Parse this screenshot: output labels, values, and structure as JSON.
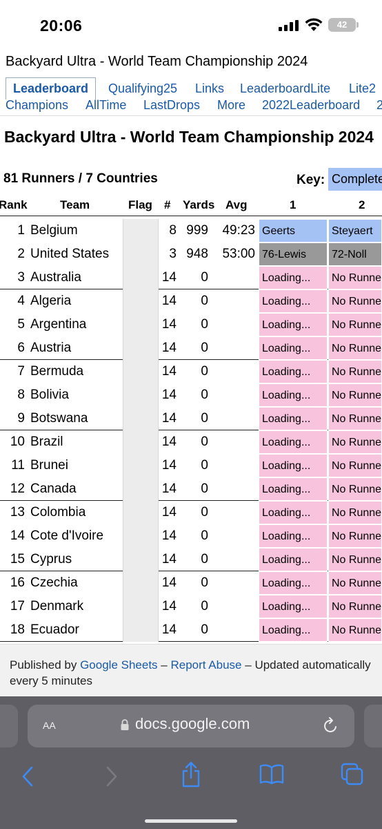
{
  "status_bar": {
    "time": "20:06",
    "battery": "42"
  },
  "document": {
    "title": "Backyard Ultra - World Team Championship 2024",
    "heading": "Backyard Ultra - World Team Championship 2024"
  },
  "tabs": [
    {
      "label": "Leaderboard",
      "active": true
    },
    {
      "label": "Qualifying25"
    },
    {
      "label": "Links"
    },
    {
      "label": "LeaderboardLite"
    },
    {
      "label": "Lite2"
    },
    {
      "label": "Champions"
    },
    {
      "label": "AllTime"
    },
    {
      "label": "LastDrops"
    },
    {
      "label": "More"
    },
    {
      "label": "2022Leaderboard"
    },
    {
      "label": "2"
    }
  ],
  "summary": {
    "runners_countries": "81 Runners / 7 Countries",
    "key_label": "Key:",
    "key_value": "Completed"
  },
  "table": {
    "headers": {
      "rank": "Rank",
      "team": "Team",
      "flag": "Flag",
      "num": "#",
      "yards": "Yards",
      "avg": "Avg",
      "col1": "1",
      "col2": "2"
    },
    "rows": [
      {
        "rank": "1",
        "team": "Belgium",
        "num": "8",
        "yards": "999",
        "avg": "49:23",
        "c1": "Geerts",
        "c1_status": "blue",
        "c2": "Steyaert",
        "c2_status": "blue"
      },
      {
        "rank": "2",
        "team": "United States",
        "num": "3",
        "yards": "948",
        "avg": "53:00",
        "c1": "76-Lewis",
        "c1_status": "gray",
        "c2": "72-Noll",
        "c2_status": "gray"
      },
      {
        "rank": "3",
        "team": "Australia",
        "num": "14",
        "yards": "0",
        "avg": "",
        "c1": "Loading...",
        "c1_status": "pink",
        "c2": "No Runner",
        "c2_status": "pink"
      },
      {
        "rank": "4",
        "team": "Algeria",
        "num": "14",
        "yards": "0",
        "avg": "",
        "c1": "Loading...",
        "c1_status": "pink",
        "c2": "No Runner",
        "c2_status": "pink"
      },
      {
        "rank": "5",
        "team": "Argentina",
        "num": "14",
        "yards": "0",
        "avg": "",
        "c1": "Loading...",
        "c1_status": "pink",
        "c2": "No Runner",
        "c2_status": "pink"
      },
      {
        "rank": "6",
        "team": "Austria",
        "num": "14",
        "yards": "0",
        "avg": "",
        "c1": "Loading...",
        "c1_status": "pink",
        "c2": "No Runner",
        "c2_status": "pink"
      },
      {
        "rank": "7",
        "team": "Bermuda",
        "num": "14",
        "yards": "0",
        "avg": "",
        "c1": "Loading...",
        "c1_status": "pink",
        "c2": "No Runner",
        "c2_status": "pink"
      },
      {
        "rank": "8",
        "team": "Bolivia",
        "num": "14",
        "yards": "0",
        "avg": "",
        "c1": "Loading...",
        "c1_status": "pink",
        "c2": "No Runner",
        "c2_status": "pink"
      },
      {
        "rank": "9",
        "team": "Botswana",
        "num": "14",
        "yards": "0",
        "avg": "",
        "c1": "Loading...",
        "c1_status": "pink",
        "c2": "No Runner",
        "c2_status": "pink"
      },
      {
        "rank": "10",
        "team": "Brazil",
        "num": "14",
        "yards": "0",
        "avg": "",
        "c1": "Loading...",
        "c1_status": "pink",
        "c2": "No Runner",
        "c2_status": "pink"
      },
      {
        "rank": "11",
        "team": "Brunei",
        "num": "14",
        "yards": "0",
        "avg": "",
        "c1": "Loading...",
        "c1_status": "pink",
        "c2": "No Runner",
        "c2_status": "pink"
      },
      {
        "rank": "12",
        "team": "Canada",
        "num": "14",
        "yards": "0",
        "avg": "",
        "c1": "Loading...",
        "c1_status": "pink",
        "c2": "No Runner",
        "c2_status": "pink"
      },
      {
        "rank": "13",
        "team": "Colombia",
        "num": "14",
        "yards": "0",
        "avg": "",
        "c1": "Loading...",
        "c1_status": "pink",
        "c2": "No Runner",
        "c2_status": "pink"
      },
      {
        "rank": "14",
        "team": "Cote d'Ivoire",
        "num": "14",
        "yards": "0",
        "avg": "",
        "c1": "Loading...",
        "c1_status": "pink",
        "c2": "No Runner",
        "c2_status": "pink"
      },
      {
        "rank": "15",
        "team": "Cyprus",
        "num": "14",
        "yards": "0",
        "avg": "",
        "c1": "Loading...",
        "c1_status": "pink",
        "c2": "No Runner",
        "c2_status": "pink"
      },
      {
        "rank": "16",
        "team": "Czechia",
        "num": "14",
        "yards": "0",
        "avg": "",
        "c1": "Loading...",
        "c1_status": "pink",
        "c2": "No Runner",
        "c2_status": "pink"
      },
      {
        "rank": "17",
        "team": "Denmark",
        "num": "14",
        "yards": "0",
        "avg": "",
        "c1": "Loading...",
        "c1_status": "pink",
        "c2": "No Runner",
        "c2_status": "pink"
      },
      {
        "rank": "18",
        "team": "Ecuador",
        "num": "14",
        "yards": "0",
        "avg": "",
        "c1": "Loading...",
        "c1_status": "pink",
        "c2": "No Runner",
        "c2_status": "pink"
      }
    ]
  },
  "footer": {
    "published_by": "Published by",
    "google_sheets": "Google Sheets",
    "dash1": "–",
    "report_abuse": "Report Abuse",
    "dash2": "–",
    "updated": "Updated automatically every 5 minutes"
  },
  "browser": {
    "aa_label": "AA",
    "url": "docs.google.com"
  },
  "colors": {
    "link": "#1a5aa6",
    "completed": "#a4c2f4",
    "dropped": "#999999",
    "no_runner": "#f8c3dd"
  }
}
